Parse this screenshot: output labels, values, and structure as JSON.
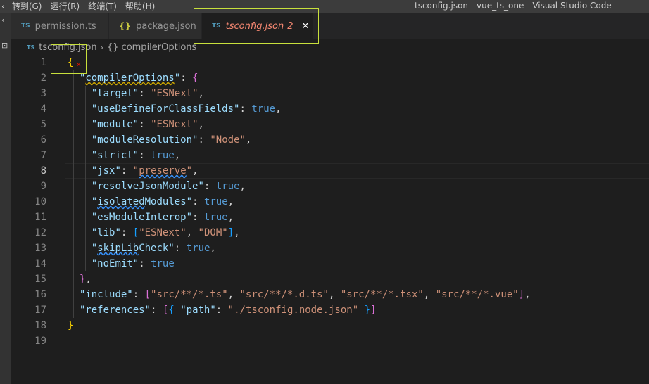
{
  "menu": {
    "items": [
      "转到(G)",
      "运行(R)",
      "终端(T)",
      "帮助(H)"
    ],
    "window_title": "tsconfig.json - vue_ts_one - Visual Studio Code"
  },
  "tabs": [
    {
      "icon": "TS",
      "label": "permission.ts"
    },
    {
      "icon": "{}",
      "label": "package.json"
    },
    {
      "icon": "TS",
      "label": "tsconfig.json",
      "badge": "2",
      "active": true
    }
  ],
  "breadcrumbs": {
    "icon": "TS",
    "file": "tsconfig.json",
    "separator": "›",
    "symbol_icon": "{}",
    "symbol": "compilerOptions"
  },
  "lines": [
    {
      "num": "1",
      "code": "{"
    },
    {
      "num": "2",
      "code": "  \"compilerOptions\": {"
    },
    {
      "num": "3",
      "code": "    \"target\": \"ESNext\","
    },
    {
      "num": "4",
      "code": "    \"useDefineForClassFields\": true,"
    },
    {
      "num": "5",
      "code": "    \"module\": \"ESNext\","
    },
    {
      "num": "6",
      "code": "    \"moduleResolution\": \"Node\","
    },
    {
      "num": "7",
      "code": "    \"strict\": true,"
    },
    {
      "num": "8",
      "code": "    \"jsx\": \"preserve\","
    },
    {
      "num": "9",
      "code": "    \"resolveJsonModule\": true,"
    },
    {
      "num": "10",
      "code": "    \"isolatedModules\": true,"
    },
    {
      "num": "11",
      "code": "    \"esModuleInterop\": true,"
    },
    {
      "num": "12",
      "code": "    \"lib\": [\"ESNext\", \"DOM\"],"
    },
    {
      "num": "13",
      "code": "    \"skipLibCheck\": true,"
    },
    {
      "num": "14",
      "code": "    \"noEmit\": true"
    },
    {
      "num": "15",
      "code": "  },"
    },
    {
      "num": "16",
      "code": "  \"include\": [\"src/**/*.ts\", \"src/**/*.d.ts\", \"src/**/*.tsx\", \"src/**/*.vue\"],"
    },
    {
      "num": "17",
      "code": "  \"references\": [{ \"path\": \"./tsconfig.node.json\" }]"
    },
    {
      "num": "18",
      "code": "}"
    },
    {
      "num": "19",
      "code": ""
    }
  ],
  "editor": {
    "current_line": "8"
  },
  "colors": {
    "key": "#9cdcfe",
    "string": "#ce9178",
    "boolean": "#569cd6",
    "tab_error": "#f48771",
    "annotation": "#c8e03c"
  }
}
